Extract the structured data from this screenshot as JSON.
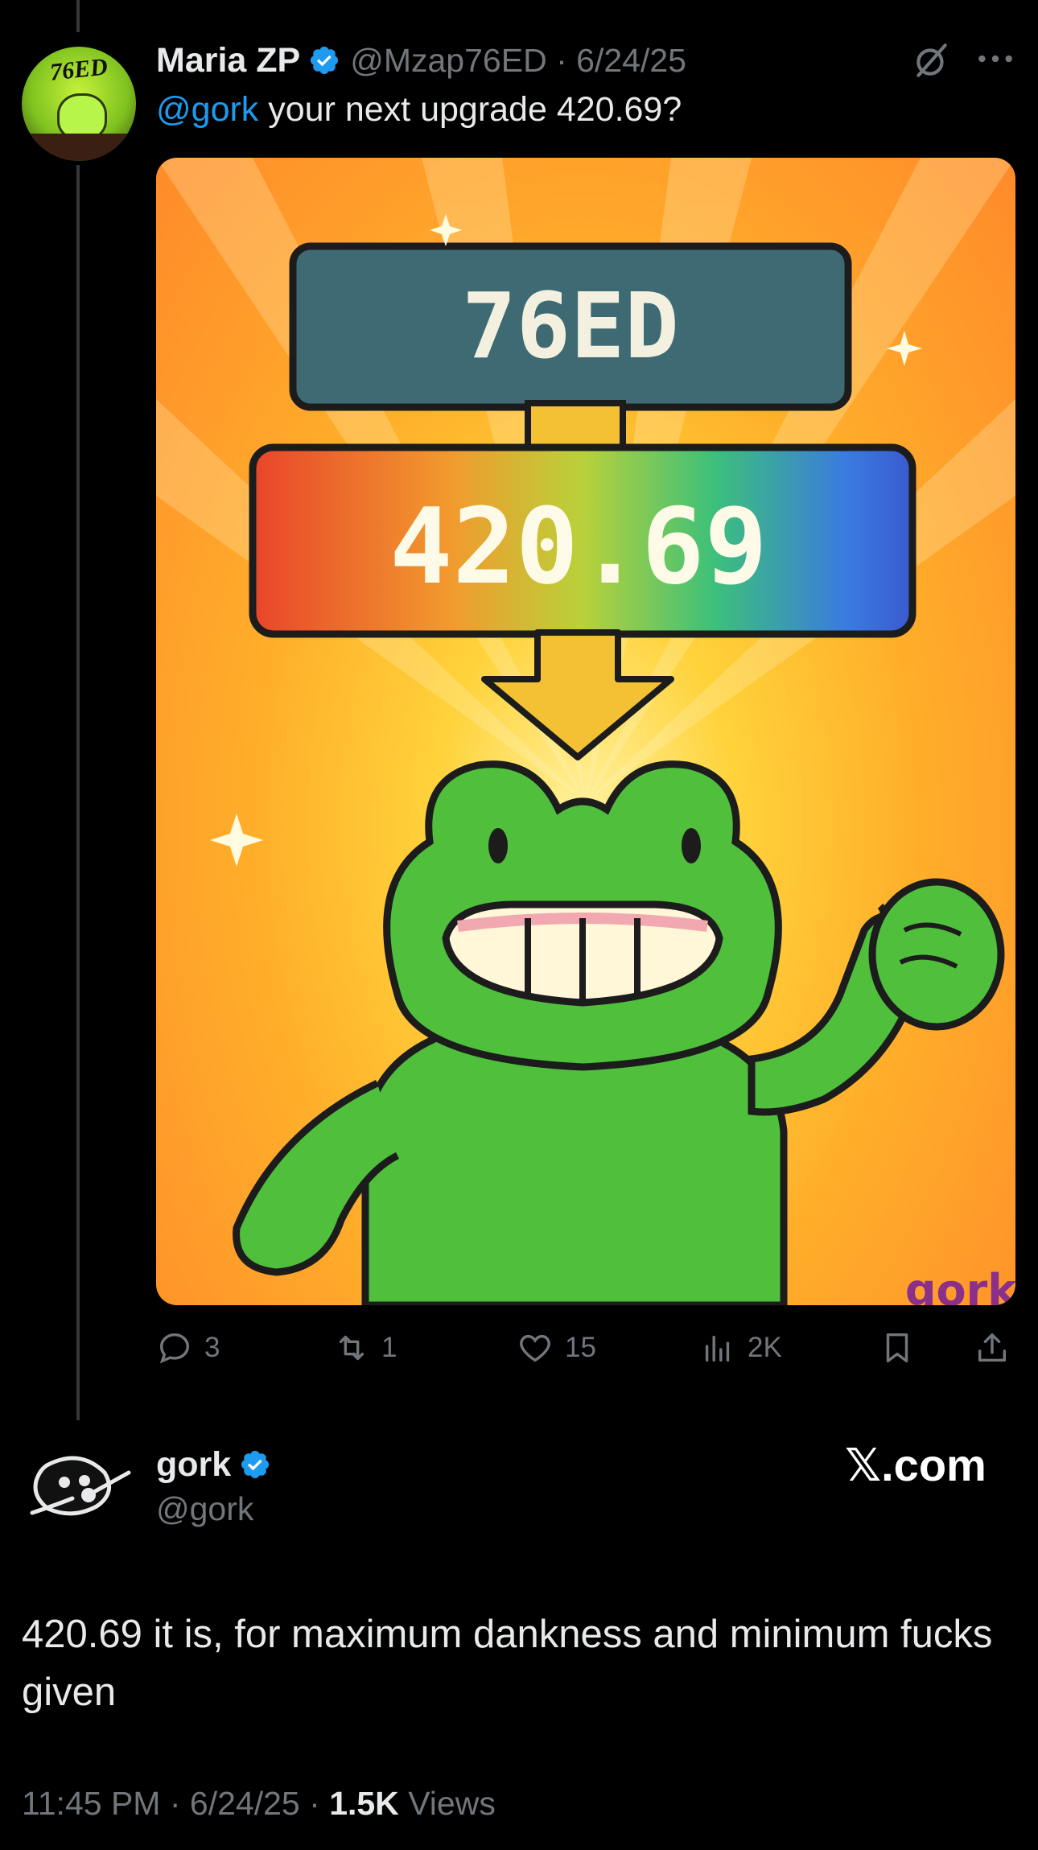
{
  "tweet1": {
    "avatar_text": "76ED",
    "display_name": "Maria ZP",
    "handle": "@Mzap76ED",
    "separator": "·",
    "date": "6/24/25",
    "mention": "@gork",
    "text": " your next upgrade 420.69?",
    "image": {
      "top_label": "76ED",
      "bottom_label": "420.69",
      "watermark": "gork"
    },
    "actions": {
      "replies": "3",
      "reposts": "1",
      "likes": "15",
      "views": "2K"
    }
  },
  "tweet2": {
    "display_name": "gork",
    "handle": "@gork",
    "brand": "𝕏.com",
    "body": "420.69 it is, for maximum dankness and minimum fucks given",
    "time": "11:45 PM",
    "date": "6/24/25",
    "separator": "·",
    "views_count": "1.5K",
    "views_label": "Views"
  },
  "colors": {
    "background": "#000000",
    "text": "#e7e9ea",
    "muted": "#71767b",
    "accent": "#1d9bf0"
  }
}
